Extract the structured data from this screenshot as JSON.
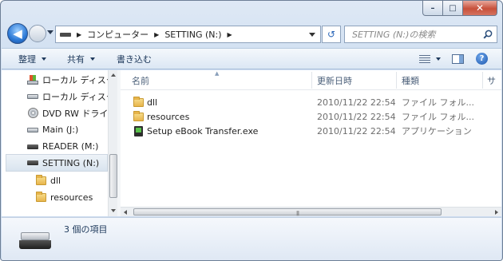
{
  "window": {
    "caption": {
      "minimize": "–",
      "maximize": "□",
      "close": "✕"
    }
  },
  "address_bar": {
    "crumbs": [
      "コンピューター",
      "SETTING (N:)"
    ],
    "search_placeholder": "SETTING (N:)の検索",
    "back_glyph": "◀",
    "refresh_glyph": "↺"
  },
  "toolbar": {
    "organize": "整理",
    "share": "共有",
    "burn": "書き込む",
    "help_glyph": "?"
  },
  "nav_pane": {
    "items": [
      {
        "label": "ローカル ディスク (C:)",
        "icon": "hdd-windows-icon"
      },
      {
        "label": "ローカル ディスク (D:)",
        "icon": "hdd-icon"
      },
      {
        "label": "DVD RW ドライブ",
        "icon": "dvd-icon"
      },
      {
        "label": "Main (J:)",
        "icon": "hdd-icon"
      },
      {
        "label": "READER (M:)",
        "icon": "removable-drive-icon"
      },
      {
        "label": "SETTING (N:)",
        "icon": "removable-drive-icon",
        "selected": true
      },
      {
        "label": "dll",
        "icon": "folder-icon"
      },
      {
        "label": "resources",
        "icon": "folder-icon"
      }
    ]
  },
  "file_list": {
    "columns": [
      "名前",
      "更新日時",
      "種類",
      "サ"
    ],
    "rows": [
      {
        "name": "dll",
        "modified": "2010/11/22 22:54",
        "type": "ファイル フォル...",
        "icon": "folder-icon"
      },
      {
        "name": "resources",
        "modified": "2010/11/22 22:54",
        "type": "ファイル フォル...",
        "icon": "folder-icon"
      },
      {
        "name": "Setup eBook Transfer.exe",
        "modified": "2010/11/22 22:54",
        "type": "アプリケーション",
        "icon": "application-icon"
      }
    ]
  },
  "details_pane": {
    "item_count": "3 個の項目"
  }
}
